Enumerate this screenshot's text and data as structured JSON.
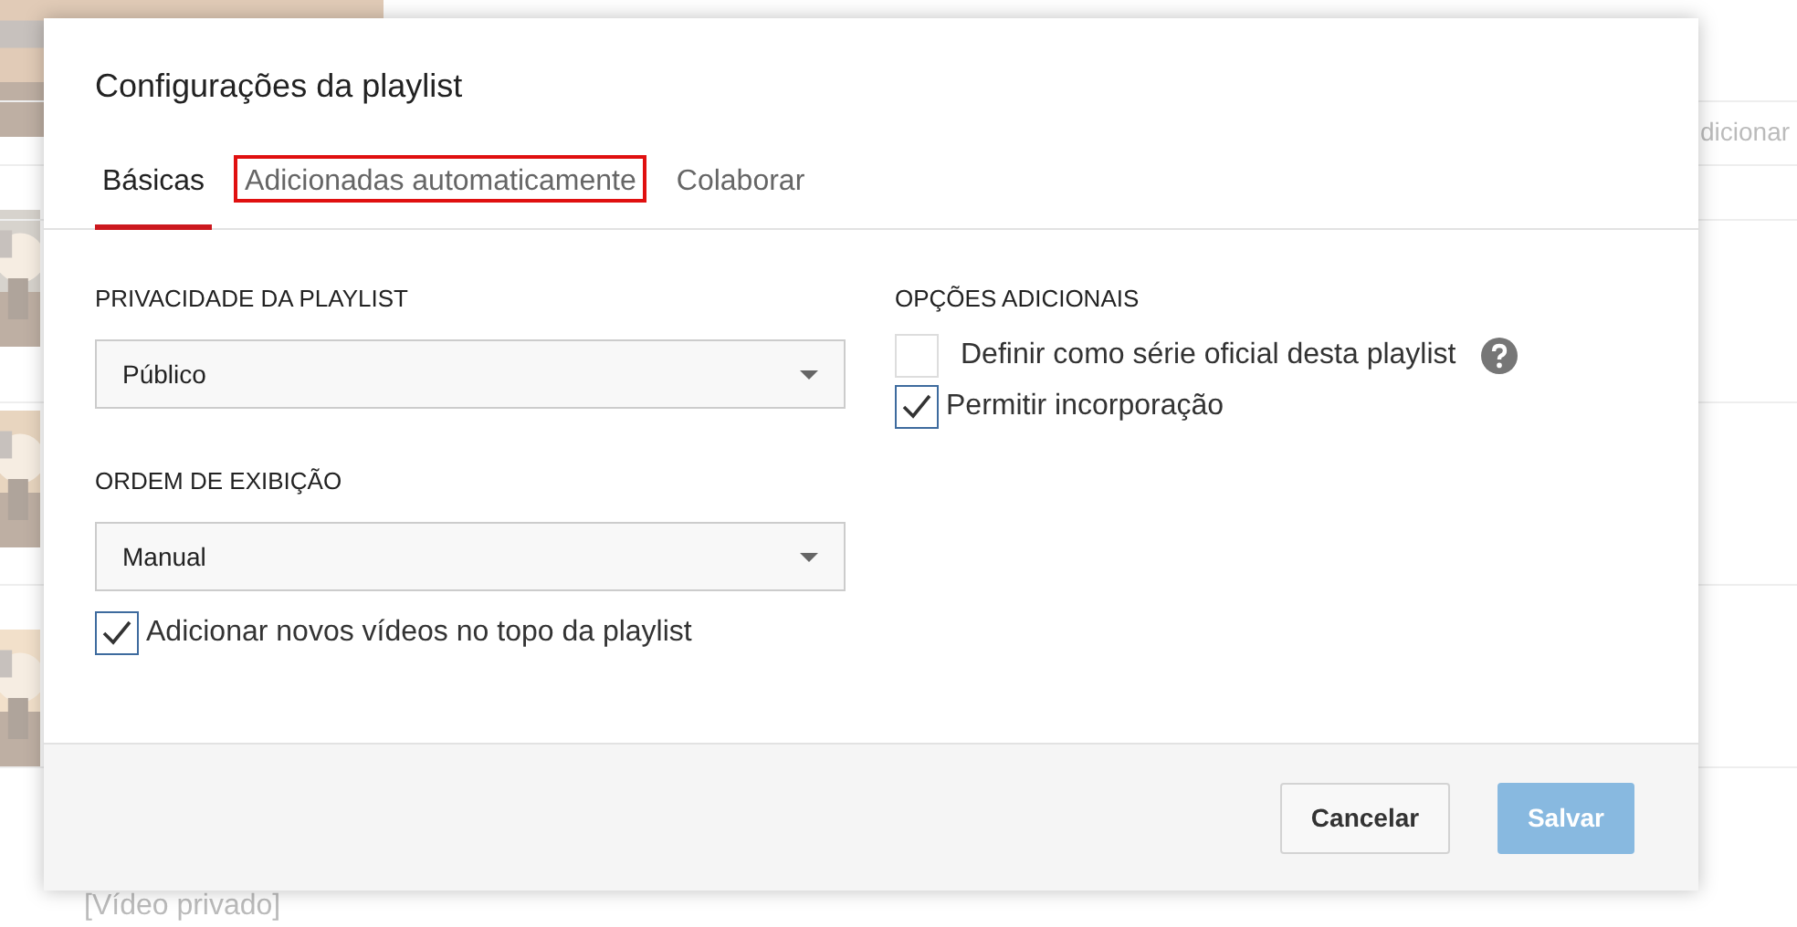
{
  "background": {
    "side_text": "dicionar",
    "row_text": "[Vídeo privado]"
  },
  "dialog": {
    "title": "Configurações da playlist",
    "tabs": [
      {
        "label": "Básicas",
        "selected": true,
        "highlighted": false
      },
      {
        "label": "Adicionadas automaticamente",
        "selected": false,
        "highlighted": true
      },
      {
        "label": "Colaborar",
        "selected": false,
        "highlighted": false
      }
    ],
    "privacy": {
      "label": "PRIVACIDADE DA PLAYLIST",
      "value": "Público"
    },
    "order": {
      "label": "ORDEM DE EXIBIÇÃO",
      "value": "Manual"
    },
    "add_to_top": {
      "label": "Adicionar novos vídeos no topo da playlist",
      "checked": true
    },
    "additional": {
      "label": "OPÇÕES ADICIONAIS",
      "options": [
        {
          "label": "Definir como série oficial desta playlist",
          "checked": false,
          "help": true
        },
        {
          "label": "Permitir incorporação",
          "checked": true,
          "help": false
        }
      ]
    },
    "buttons": [
      {
        "label": "Cancelar",
        "kind": "secondary"
      },
      {
        "label": "Salvar",
        "kind": "primary"
      }
    ]
  }
}
